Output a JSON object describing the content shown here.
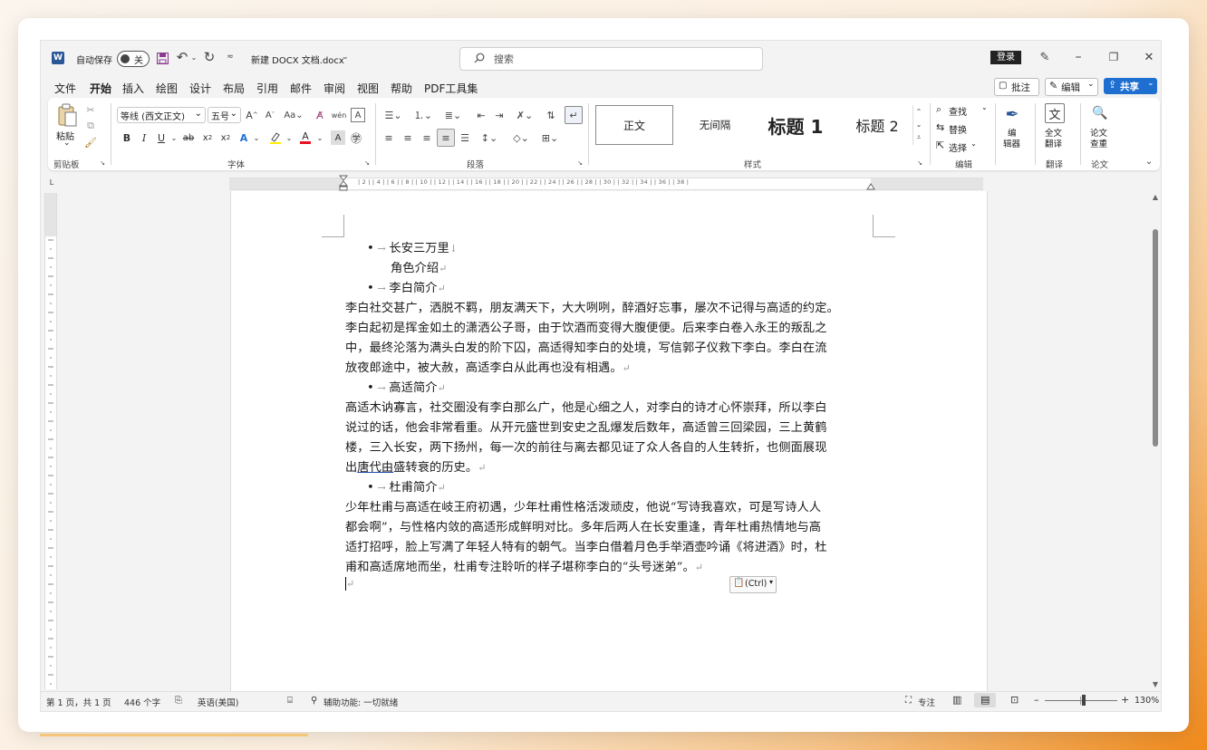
{
  "titlebar": {
    "autosave_label": "自动保存",
    "autosave_state": "关",
    "doc_title": "新建 DOCX 文档.docx",
    "search_placeholder": "搜索",
    "login_label": "登录"
  },
  "tabs": [
    "文件",
    "开始",
    "插入",
    "绘图",
    "设计",
    "布局",
    "引用",
    "邮件",
    "审阅",
    "视图",
    "帮助",
    "PDF工具集"
  ],
  "actions": {
    "comments": "批注",
    "edit": "编辑",
    "share": "共享"
  },
  "ribbon": {
    "paste": "粘贴",
    "font_name": "等线 (西文正文)",
    "font_size": "五号",
    "styles": [
      "正文",
      "无间隔",
      "标题 1",
      "标题 2"
    ],
    "find": "查找",
    "replace": "替换",
    "select": "选择",
    "editor": [
      "编",
      "辑器"
    ],
    "fulltext_translate": [
      "全文",
      "翻译"
    ],
    "paper_check": [
      "论文",
      "查重"
    ],
    "groups": [
      "剪贴板",
      "字体",
      "段落",
      "样式",
      "编辑",
      "翻译",
      "论文"
    ]
  },
  "ruler_top": "| 2 | | 4 | | 6 | | 8 | | 10 | | 12 | | 14 | | 16 | | 18 | | 20 | | 22 | | 24 | | 26 | | 28 | | 30 | | 32 | | 34 | | 36 | | 38 |",
  "document": {
    "bullet1": "长安三万里",
    "line_role": "角色介绍",
    "bullet2": "李白简介",
    "para1": [
      "李白社交甚广，洒脱不羁，朋友满天下，大大咧咧，醉酒好忘事，屡次不记得与高适的约定。",
      "李白起初是挥金如土的潇洒公子哥，由于饮酒而变得大腹便便。后来李白卷入永王的叛乱之",
      "中，最终沦落为满头白发的阶下囚，高适得知李白的处境，写信郭子仪救下李白。李白在流",
      "放夜郎途中，被大赦，高适李白从此再也没有相遇。"
    ],
    "bullet3": "高适简介",
    "para2": [
      "高适木讷寡言，社交圈没有李白那么广，他是心细之人，对李白的诗才心怀崇拜，所以李白",
      "说过的话，他会非常看重。从开元盛世到安史之乱爆发后数年，高适曾三回梁园，三上黄鹤",
      "楼，三入长安，两下扬州，每一次的前往与离去都见证了众人各自的人生转折，也侧面展现"
    ],
    "para2_last_a": "出",
    "para2_last_link": "唐代由",
    "para2_last_b": "盛转衰的历史。",
    "bullet4": "杜甫简介",
    "para3": [
      "少年杜甫与高适在岐王府初遇，少年杜甫性格活泼顽皮，他说“写诗我喜欢，可是写诗人人",
      "都会啊”，与性格内敛的高适形成鲜明对比。多年后两人在长安重逢，青年杜甫热情地与高",
      "适打招呼，脸上写满了年轻人特有的朝气。当李白借着月色手举酒壶吟诵《将进酒》时，杜",
      "甫和高适席地而坐，杜甫专注聆听的样子堪称李白的“头号迷弟”。"
    ],
    "paste_options": "(Ctrl)"
  },
  "statusbar": {
    "page": "第 1 页，共 1 页",
    "words": "446 个字",
    "language": "英语(美国)",
    "accessibility": "辅助功能: 一切就绪",
    "focus": "专注",
    "zoom": "130%"
  },
  "colors": {
    "accent": "#2b5797",
    "share_bg": "#1f6fd1",
    "font_color": "#e81123",
    "highlight": "#ffee00"
  }
}
